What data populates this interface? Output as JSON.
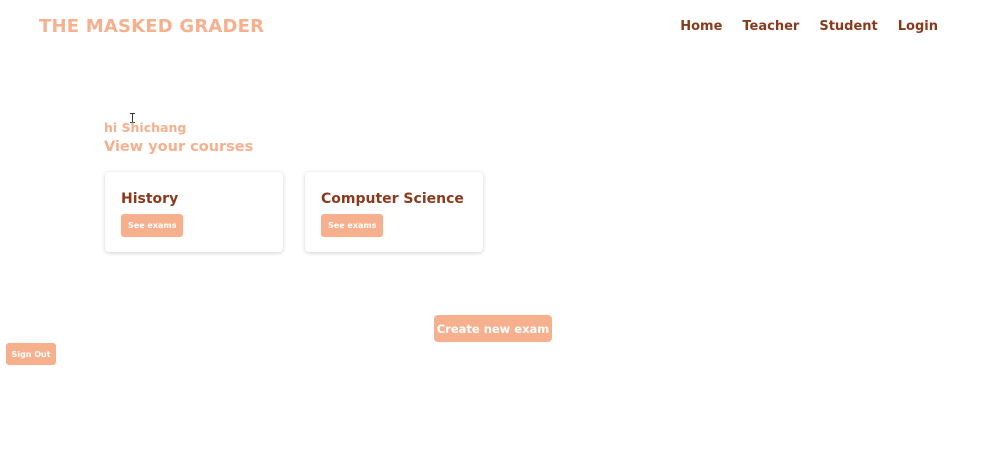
{
  "brand": {
    "title": "THE MASKED GRADER"
  },
  "nav": {
    "items": [
      {
        "label": "Home"
      },
      {
        "label": "Teacher"
      },
      {
        "label": "Student"
      },
      {
        "label": "Login"
      }
    ]
  },
  "main": {
    "greeting": "hi Shichang",
    "subheading": "View your courses",
    "courses": [
      {
        "title": "History",
        "button_label": "See exams"
      },
      {
        "title": "Computer Science",
        "button_label": "See exams"
      }
    ],
    "create_button_label": "Create new exam"
  },
  "sidebar": {
    "signout_label": "Sign Out"
  },
  "colors": {
    "accent": "#f7b08e",
    "nav_text": "#8a3a1c",
    "background": "#ffffff"
  }
}
